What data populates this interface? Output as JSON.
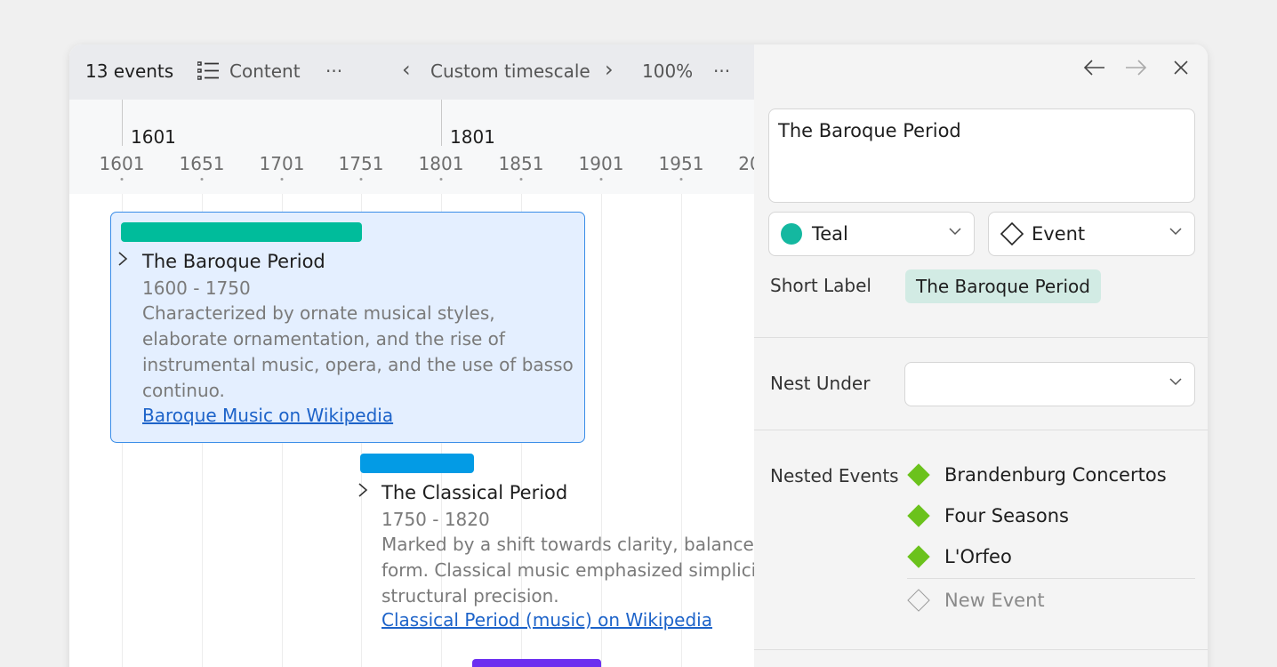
{
  "toolbar": {
    "event_count": "13 events",
    "content_label": "Content",
    "more": "···",
    "prev": "‹",
    "timescale": "Custom timescale",
    "next": "›",
    "zoom": "100%",
    "more2": "···"
  },
  "ruler": {
    "major_labels": [
      "1601",
      "1801"
    ],
    "ticks": [
      "1601",
      "1651",
      "1701",
      "1751",
      "1801",
      "1851",
      "1901",
      "1951",
      "20"
    ]
  },
  "events": [
    {
      "title": "The Baroque Period",
      "dates": "1600 - 1750",
      "desc": [
        "Characterized by ornate musical styles,",
        "elaborate ornamentation, and the rise of",
        "instrumental music, opera, and the use of basso",
        "continuo."
      ],
      "link": "Baroque Music on Wikipedia",
      "color": "#00bc9b"
    },
    {
      "title": "The Classical Period",
      "dates": "1750 - 1820",
      "desc": [
        "Marked by a shift towards clarity, balance",
        "form. Classical music emphasized simplici",
        "structural precision."
      ],
      "link": "Classical Period (music) on Wikipedia",
      "color": "#039be5"
    },
    {
      "color": "#6b2ff0"
    }
  ],
  "inspector": {
    "title_value": "The Baroque Period",
    "color_select": "Teal",
    "color_hex": "#14b8a0",
    "type_select": "Event",
    "short_label_caption": "Short Label",
    "short_label_value": "The Baroque Period",
    "nest_under_caption": "Nest Under",
    "nested_events_caption": "Nested Events",
    "nested_events": [
      "Brandenburg Concertos",
      "Four Seasons",
      "L'Orfeo"
    ],
    "nested_color": "#6bc21c",
    "new_event": "New Event"
  }
}
